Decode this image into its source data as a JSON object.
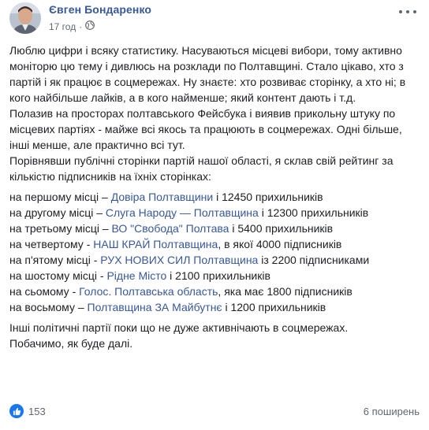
{
  "post": {
    "author": "Євген Бондаренко",
    "time": "17 год",
    "dot": "·",
    "paragraph1": "Люблю цифри і всяку статистику. Насуваються місцеві вибори, тому активно моніторю цю тему і дивлюсь на розклади по Полтавщині. Стало цікаво, хто з партій і як працює в соцмережах. Ну знаєте: хто розвиває сторінку, а хто ні; в кого найбільше лайків, а в кого найменше; який контент дають і т.д.",
    "paragraph2": "Полазив на просторах полтавського Фейсбука і виявив прикольну штуку по місцевих партіях - майже всі якось та працюють в соцмережах. Одні більше, інші менше, але практично всі тут.",
    "paragraph3": "Порівнявши публічні сторінки партій нашої області, я склав свій рейтинг за кількістю підписників на їхніх сторінках:",
    "ranking": [
      {
        "prefix": "на першому місці – ",
        "party": "Довіра Полтавщини",
        "suffix": " і 12450 прихильників"
      },
      {
        "prefix": "на другому місці – ",
        "party": "Слуга Народу — Полтавщина",
        "suffix": " і 12300 прихильників"
      },
      {
        "prefix": "на третьому місці – ",
        "party": "ВО \"Свобода\" Полтава",
        "suffix": " і 5400 прихильників"
      },
      {
        "prefix": "на четвертому - ",
        "party": "НАШ КРАЙ Полтавщина",
        "suffix": ", в якої 4000 підписників"
      },
      {
        "prefix": "на п'ятому місці - ",
        "party": "РУХ НОВИХ СИЛ Полтавщина",
        "suffix": " із 2200 підписниками"
      },
      {
        "prefix": "на шостому місці - ",
        "party": "Рідне Місто",
        "suffix": " і 2100 прихильників"
      },
      {
        "prefix": "на сьомому - ",
        "party": "Голос. Полтавська область",
        "suffix": ", яка має 1800 підписників"
      },
      {
        "prefix": "на восьмому – ",
        "party": "Полтавщина ЗА Майбутнє",
        "suffix": " і 1200 прихильників"
      }
    ],
    "closing1": "Інші політичні партії поки що не дуже активнічають в соцмережах.",
    "closing2": "Побачимо, як буде далі."
  },
  "footer": {
    "likes": "153",
    "shares": "6 поширень"
  },
  "icons": {
    "globe": "globe-icon",
    "like": "like-icon",
    "more": "more-options-icon"
  },
  "colors": {
    "link": "#385898",
    "text": "#1c1e21",
    "meta": "#616770",
    "like_badge": "#1877f2"
  }
}
